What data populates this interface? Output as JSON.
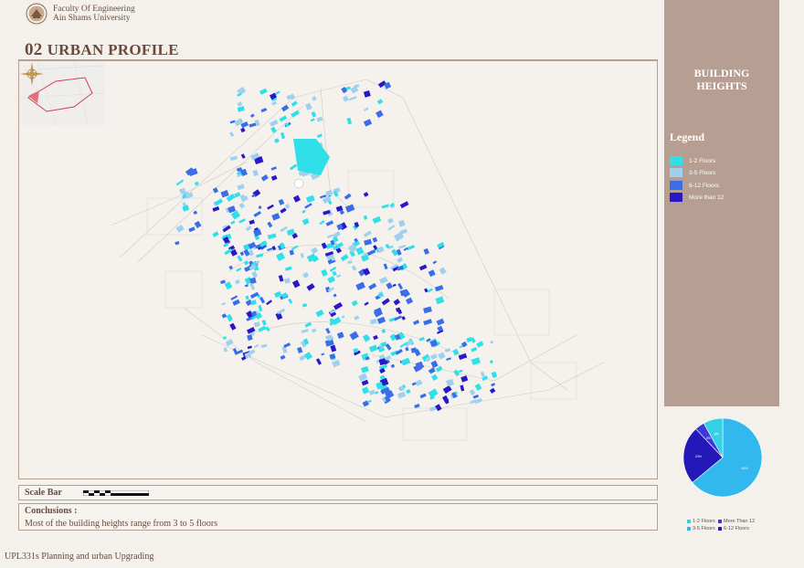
{
  "header": {
    "faculty_line1": "Faculty Of Engineering",
    "faculty_line2": "Ain Shams University"
  },
  "section": {
    "number": "02",
    "title": "URBAN PROFILE"
  },
  "panel": {
    "title_line1": "BUILDING",
    "title_line2": "HEIGHTS",
    "legend_title": "Legend",
    "legend": [
      {
        "label": "1-2 Floors",
        "color": "#2fe0e8"
      },
      {
        "label": "3-5 Floors",
        "color": "#9fd0f0"
      },
      {
        "label": "6-12 Floors",
        "color": "#3a6ee8"
      },
      {
        "label": "More than 12",
        "color": "#2a18c8"
      }
    ]
  },
  "scale_bar": {
    "label": "Scale Bar"
  },
  "conclusions": {
    "heading": "Conclusions :",
    "text": "Most of the building heights range from 3 to 5 floors"
  },
  "footer": {
    "text": "UPL331s Planning and urban Upgrading"
  },
  "chart_data": {
    "type": "pie",
    "slices": [
      {
        "name": "3-5 Floors",
        "value": 64,
        "label": "64%",
        "color": "#33b8ee"
      },
      {
        "name": "6-12 Floors",
        "value": 24,
        "label": "24%",
        "color": "#2418b8"
      },
      {
        "name": "More Than 12",
        "value": 4,
        "label": "4%",
        "color": "#3a3ad8"
      },
      {
        "name": "1-2 Floors",
        "value": 8,
        "label": "8%",
        "color": "#34d0e6"
      }
    ],
    "legend": [
      "1-2 Floors",
      "More Than 12",
      "3-5 Floors",
      "6-12 Floors"
    ]
  }
}
